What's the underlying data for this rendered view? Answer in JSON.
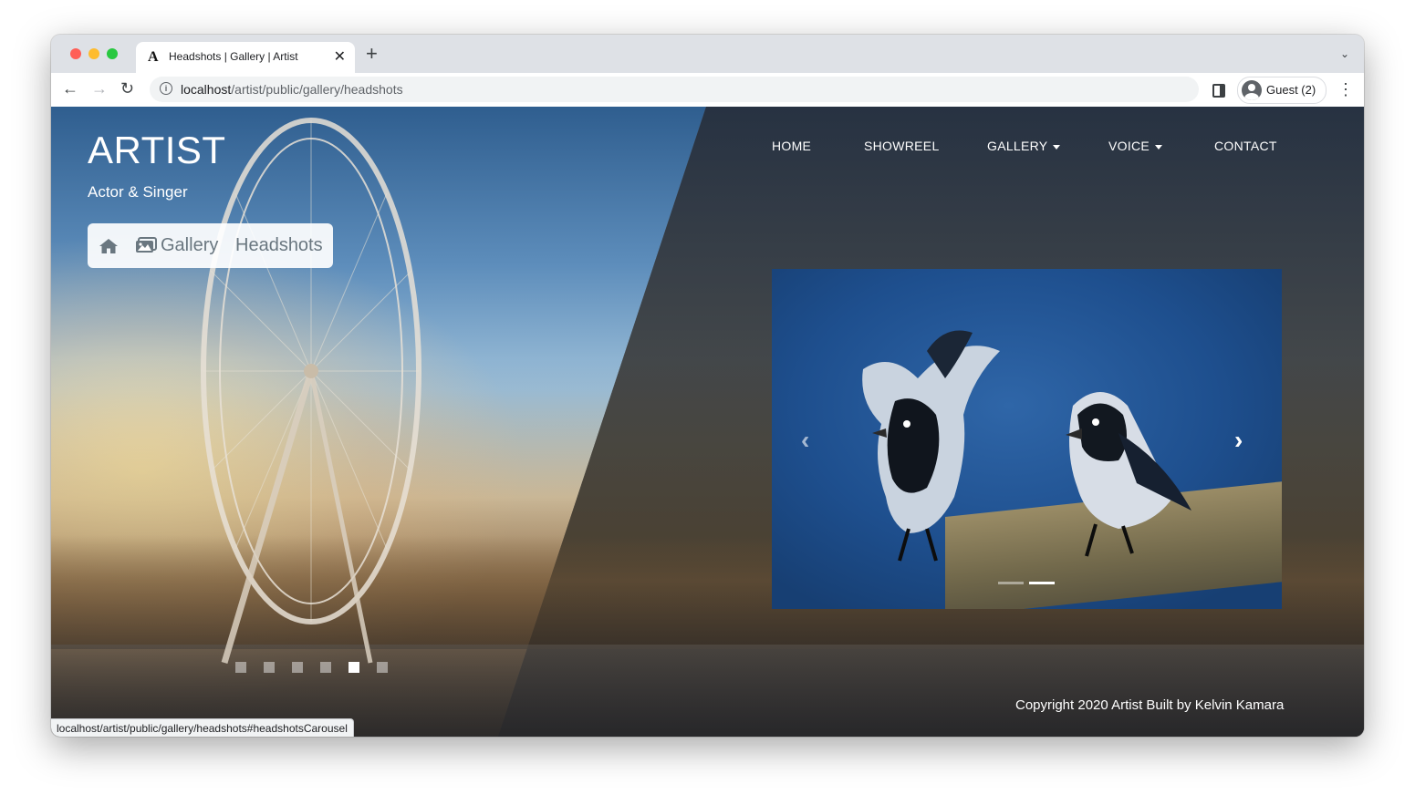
{
  "browser": {
    "tab_title": "Headshots | Gallery | Artist",
    "tab_favicon": "A",
    "tab_close": "✕",
    "new_tab": "+",
    "tab_search": "⌄",
    "url_host": "localhost",
    "url_path": "/artist/public/gallery/headshots",
    "profile_label": "Guest (2)",
    "back": "←",
    "forward": "→",
    "reload": "↻",
    "menu": "⋮",
    "info": "i",
    "status_text": "localhost/artist/public/gallery/headshots#headshotsCarousel"
  },
  "site": {
    "brand": "ARTIST",
    "tagline": "Actor & Singer",
    "breadcrumb": {
      "home_icon": "home-icon",
      "gallery_icon": "images-icon",
      "gallery": "Gallery",
      "current": "Headshots"
    },
    "nav": {
      "home": "HOME",
      "showreel": "SHOWREEL",
      "gallery": "GALLERY",
      "voice": "VOICE",
      "contact": "CONTACT"
    },
    "carousel": {
      "prev": "‹",
      "next": "›",
      "active_slide": 2,
      "slide_count": 2
    },
    "background_slides": {
      "active_index": 5,
      "count": 6
    },
    "copyright": "Copyright 2020 Artist Built by Kelvin Kamara"
  },
  "colors": {
    "brand_text": "#ffffff",
    "breadcrumb_text": "#6a7780",
    "carousel_bg": "#1e4f8e"
  }
}
